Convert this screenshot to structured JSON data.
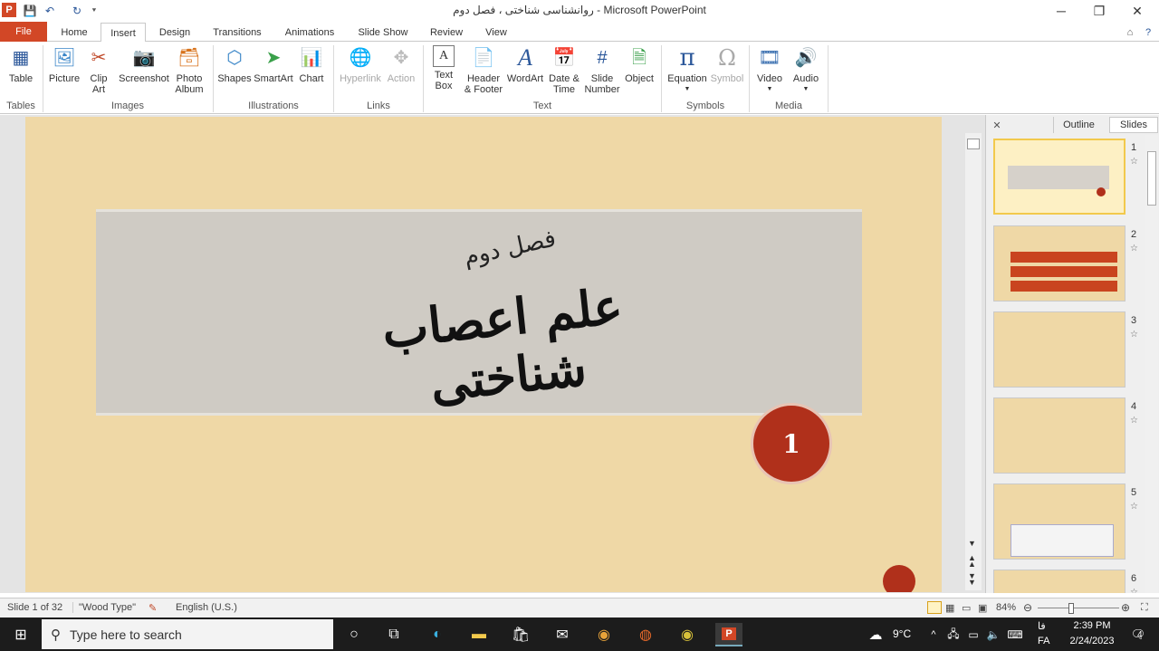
{
  "window": {
    "title": "روانشناسی شناختی ، فصل دوم  -  Microsoft PowerPoint",
    "minimize_icon": "minimize-icon",
    "maximize_icon": "restore-icon",
    "close_icon": "close-icon"
  },
  "qat": {
    "logo": "P",
    "save": "💾",
    "undo": "↶",
    "redo": "↻",
    "customize": "⯆"
  },
  "tabs": [
    "File",
    "Home",
    "Insert",
    "Design",
    "Transitions",
    "Animations",
    "Slide Show",
    "Review",
    "View"
  ],
  "ribbon": {
    "tables": {
      "label": "Tables",
      "buttons": [
        "Table"
      ]
    },
    "images": {
      "label": "Images",
      "buttons": [
        "Picture",
        "Clip Art",
        "Screenshot",
        "Photo Album"
      ]
    },
    "illustrations": {
      "label": "Illustrations",
      "buttons": [
        "Shapes",
        "SmartArt",
        "Chart"
      ]
    },
    "links": {
      "label": "Links",
      "buttons": [
        "Hyperlink",
        "Action"
      ]
    },
    "text": {
      "label": "Text",
      "buttons": [
        "Text Box",
        "Header & Footer",
        "WordArt",
        "Date & Time",
        "Slide Number",
        "Object"
      ]
    },
    "symbols": {
      "label": "Symbols",
      "buttons": [
        "Equation",
        "Symbol"
      ]
    },
    "media": {
      "label": "Media",
      "buttons": [
        "Video",
        "Audio"
      ]
    }
  },
  "slide": {
    "subtitle": "فصل دوم",
    "title": "علم اعصاب شناختی",
    "badge": "1"
  },
  "panel": {
    "tab_outline": "Outline",
    "tab_slides": "Slides",
    "close": "✕",
    "thumbnails": [
      {
        "num": "1",
        "selected": true
      },
      {
        "num": "2",
        "selected": false
      },
      {
        "num": "3",
        "selected": false
      },
      {
        "num": "4",
        "selected": false
      },
      {
        "num": "5",
        "selected": false
      },
      {
        "num": "6",
        "selected": false
      }
    ]
  },
  "status": {
    "slide_info": "Slide 1 of 32",
    "theme": "\"Wood Type\"",
    "language": "English (U.S.)",
    "zoom": "84%"
  },
  "taskbar": {
    "search_placeholder": "Type here to search",
    "weather": "9°C",
    "lang_top": "فا",
    "lang": "FA",
    "time": "2:39 PM",
    "date": "2/24/2023",
    "notifications": "4"
  },
  "colors": {
    "accent": "#d24726",
    "slide_bg": "#efd8a6",
    "seal": "#b0301b"
  }
}
